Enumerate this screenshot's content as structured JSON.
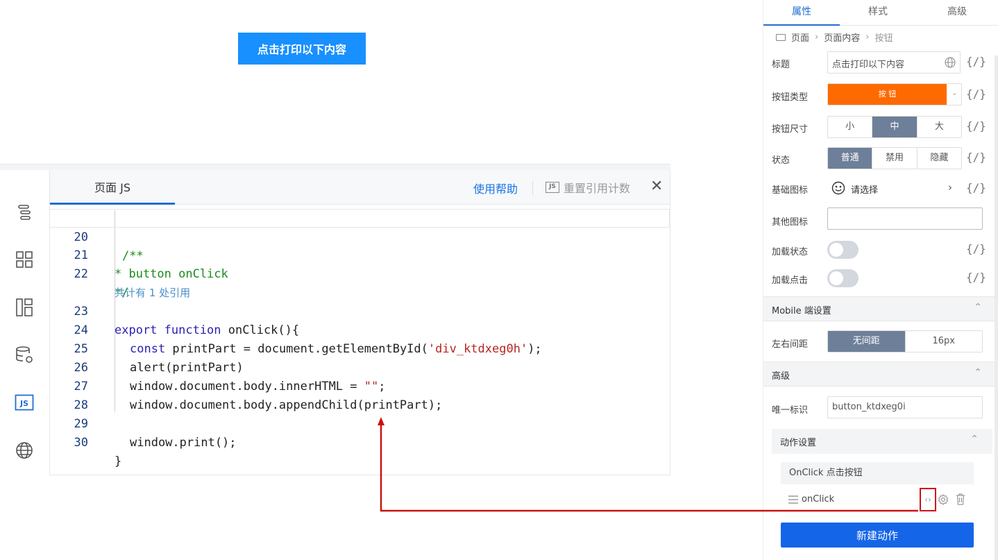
{
  "canvas": {
    "print_button": "点击打印以下内容"
  },
  "js_panel": {
    "tab": "页面 JS",
    "help": "使用帮助",
    "reset": "重置引用计数",
    "js_badge": "JS",
    "close": "✕",
    "ref_count": "共计有 1 处引用",
    "lines": {
      "l20": "20",
      "l21": "21",
      "l22": "22",
      "l23": "23",
      "l24": "24",
      "l25": "25",
      "l26": "26",
      "l27": "27",
      "l28": "28",
      "l29": "29",
      "l30": "30"
    },
    "code": {
      "c20": "/**",
      "c21": "* button onClick",
      "c22": "*/",
      "c23_kw": "export function",
      "c23_rest": " onClick(){",
      "c24_kw": "const",
      "c24_mid": " printPart = document.getElementById(",
      "c24_str": "'div_ktdxeg0h'",
      "c24_end": ");",
      "c25": "alert(printPart)",
      "c26_a": "window.document.body.innerHTML = ",
      "c26_str": "\"\"",
      "c26_end": ";",
      "c27": "window.document.body.appendChild(printPart);",
      "c29": "window.print();",
      "c30": "}"
    },
    "side_icons": [
      "outline-icon",
      "components-icon",
      "layout-icon",
      "datasource-icon",
      "js-icon",
      "globe-icon"
    ]
  },
  "props": {
    "tabs": [
      "属性",
      "样式",
      "高级"
    ],
    "breadcrumb": [
      "页面",
      "页面内容",
      "按钮"
    ],
    "bind_symbol": "{/}",
    "title_label": "标题",
    "title_value": "点击打印以下内容",
    "type_label": "按钮类型",
    "type_value": "按 钮",
    "size_label": "按钮尺寸",
    "sizes": [
      "小",
      "中",
      "大"
    ],
    "state_label": "状态",
    "states": [
      "普通",
      "禁用",
      "隐藏"
    ],
    "base_icon_label": "基础图标",
    "base_icon_value": "请选择",
    "other_icon_label": "其他图标",
    "loading_label": "加载状态",
    "loading_click_label": "加载点击",
    "mobile_section": "Mobile 端设置",
    "margin_label": "左右间距",
    "margins": [
      "无间距",
      "16px"
    ],
    "advanced_section": "高级",
    "uid_label": "唯一标识",
    "uid_value": "button_ktdxeg0i",
    "action_section": "动作设置",
    "action_head": "OnClick 点击按钮",
    "action_name": "onClick",
    "new_action": "新建动作",
    "colors": {
      "accent": "#1f6fd1",
      "orange": "#ff6a00",
      "annotation": "#cc1111"
    }
  }
}
